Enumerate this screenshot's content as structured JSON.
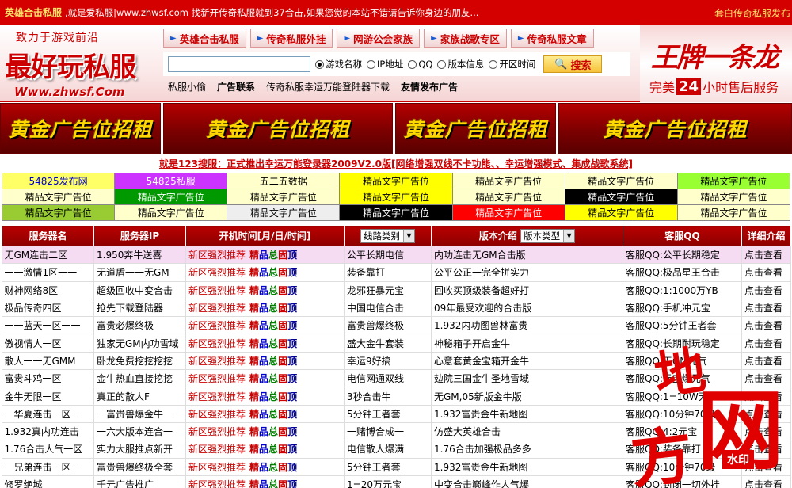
{
  "topbar": {
    "brand": "英雄合击私服",
    "intro": ",就是爱私服|www.zhwsf.com 找新开传奇私服就到37合击,如果您觉的本站不错请告诉你身边的朋友...",
    "right": "套白传奇私服发布"
  },
  "logo": {
    "slogan": "致力于游戏前沿",
    "title": "最好玩私服",
    "url": "Www.zhwsf.Com"
  },
  "nav": {
    "tabs": [
      "英雄合击私服",
      "传奇私服外挂",
      "网游公会家族",
      "家族战歌专区",
      "传奇私服文章"
    ]
  },
  "search": {
    "placeholder": "",
    "options": [
      "游戏名称",
      "IP地址",
      "QQ",
      "版本信息",
      "开区时间"
    ],
    "selected": 0,
    "button": "搜索"
  },
  "sublinks": [
    {
      "label": "私服小偷",
      "bold": false
    },
    {
      "label": "广告联系",
      "bold": true
    },
    {
      "label": "传奇私服幸运万能登陆器下载",
      "bold": false
    },
    {
      "label": "友情发布广告",
      "bold": true
    }
  ],
  "adbrand": {
    "title": "王牌一条龙",
    "sub_prefix": "完美",
    "sub_num": "24",
    "sub_suffix": "小时售后服务"
  },
  "banners": [
    "黄金广告位招租",
    "黄金广告位招租",
    "黄金广告位招租",
    "黄金广告位招租"
  ],
  "notice": "就是123搜服：正式推出幸运万能登录器2009V2.0版[网络增强双线不卡功能、、幸运增强模式、集成战歌系统]",
  "adgrid": [
    [
      {
        "text": "54825发布网",
        "bg": "#ffff66",
        "color": "#0000cc"
      },
      {
        "text": "54825私服",
        "bg": "#cc33ff",
        "color": "#ffffff"
      },
      {
        "text": "五二五数据",
        "bg": "#ffffcc",
        "color": "#000000"
      },
      {
        "text": "精品文字广告位",
        "bg": "#ffff00",
        "color": "#000000"
      },
      {
        "text": "精品文字广告位",
        "bg": "#ffffcc",
        "color": "#000000"
      },
      {
        "text": "精品文字广告位",
        "bg": "#ffffcc",
        "color": "#000000"
      },
      {
        "text": "精品文字广告位",
        "bg": "#99ff33",
        "color": "#000000"
      }
    ],
    [
      {
        "text": "精品文字广告位",
        "bg": "#ffffcc",
        "color": "#000000"
      },
      {
        "text": "精品文字广告位",
        "bg": "#009900",
        "color": "#ffffff"
      },
      {
        "text": "精品文字广告位",
        "bg": "#ffffcc",
        "color": "#000000"
      },
      {
        "text": "精品文字广告位",
        "bg": "#ffff00",
        "color": "#000000"
      },
      {
        "text": "精品文字广告位",
        "bg": "#ffffcc",
        "color": "#000000"
      },
      {
        "text": "精品文字广告位",
        "bg": "#000000",
        "color": "#ffffff"
      },
      {
        "text": "精品文字广告位",
        "bg": "#ffffcc",
        "color": "#000000"
      }
    ],
    [
      {
        "text": "精品文字广告位",
        "bg": "#99cc33",
        "color": "#000000"
      },
      {
        "text": "精品文字广告位",
        "bg": "#ffffcc",
        "color": "#000000"
      },
      {
        "text": "精品文字广告位",
        "bg": "#eeeeee",
        "color": "#000000"
      },
      {
        "text": "精品文字广告位",
        "bg": "#000000",
        "color": "#ffffff"
      },
      {
        "text": "精品文字广告位",
        "bg": "#ff0000",
        "color": "#ffffff"
      },
      {
        "text": "精品文字广告位",
        "bg": "#ffff00",
        "color": "#000000"
      },
      {
        "text": "精品文字广告位",
        "bg": "#ffffcc",
        "color": "#000000"
      }
    ]
  ],
  "table": {
    "headers": {
      "name": "服务器名",
      "ip": "服务器IP",
      "time": "开机时间[月/日/时间]",
      "line_select": "线路类别",
      "version": "版本介绍",
      "version_select": "版本类型",
      "qq": "客服QQ",
      "detail": "详细介绍"
    },
    "tag_labels": [
      "新区强烈推荐",
      "精",
      "品",
      "总",
      "固",
      "顶"
    ],
    "rows": [
      {
        "name": "无GM连击二区",
        "ip": "1.950奔牛送喜",
        "line": "公平长期电信",
        "version": "内功连击无GM合击版",
        "qq": "客服QQ:公平长期稳定",
        "detail": "点击查看"
      },
      {
        "name": "一一激情1区一一",
        "ip": "无道盾一一无GM",
        "line": "装备靠打",
        "version": "公平公正一完全拼实力",
        "qq": "客服QQ:极品星王合击",
        "detail": "点击查看"
      },
      {
        "name": "财神网络8区",
        "ip": "超级回收中变合击",
        "line": "龙邪狂暴元宝",
        "version": "回收买顶级装备超好打",
        "qq": "客服QQ:1:1000万YB",
        "detail": "点击查看"
      },
      {
        "name": "极品传奇四区",
        "ip": "抢先下载登陆器",
        "line": "中国电信合击",
        "version": "09年最受欢迎的合击版",
        "qq": "客服QQ:手机冲元宝",
        "detail": "点击查看"
      },
      {
        "name": "一一蓝天一区一一",
        "ip": "富贵必爆终极",
        "line": "富贵兽爆终极",
        "version": "1.932内功图兽林富贵",
        "qq": "客服QQ:5分钟王者套",
        "detail": "点击查看"
      },
      {
        "name": "傲视情人一区",
        "ip": "独家无GM内功雪域",
        "line": "盛大金牛套装",
        "version": "神秘箱子开启金牛",
        "qq": "客服QQ:长期耐玩稳定",
        "detail": "点击查看"
      },
      {
        "name": "散人一一无GMM",
        "ip": "卧龙免费挖挖挖挖",
        "line": "幸运9好搞",
        "version": "心意套黄金宝箱开金牛",
        "qq": "客服QQ:无GM元气",
        "detail": "点击查看"
      },
      {
        "name": "富贵斗鸡一区",
        "ip": "金牛热血直接挖挖",
        "line": "电信网通双线",
        "version": "攰院三国金牛圣地雪域",
        "qq": "客服QQ:元宝爆元气",
        "detail": "点击查看"
      },
      {
        "name": "金牛无限一区",
        "ip": "真正的散人F",
        "line": "3秒合击牛",
        "version": "无GM,05新版金牛版",
        "qq": "客服QQ:1=10W无GM",
        "detail": "点击查看"
      },
      {
        "name": "一华夏连击一区一",
        "ip": "一富贵兽爆金牛一",
        "line": "5分钟王者套",
        "version": "1.932富贵金牛新地图",
        "qq": "客服QQ:10分钟70级",
        "detail": "点击查看"
      },
      {
        "name": "1.932真内功连击",
        "ip": "一六大版本连合一",
        "line": "一赌博合成一",
        "version": "仿盛大英雄合击",
        "qq": "客服QQ:4:2元宝",
        "detail": "点击查看"
      },
      {
        "name": "1.76合击人气一区",
        "ip": "实力大服推点新开",
        "line": "电信散人爆满",
        "version": "1.76合击加强极品多多",
        "qq": "客服QQ:装备靠打",
        "detail": "点击查看"
      },
      {
        "name": "一兄弟连击一区一",
        "ip": "富贵兽爆终极全套",
        "line": "5分钟王者套",
        "version": "1.932富贵金牛新地图",
        "qq": "客服QQ:10分钟70级",
        "detail": "点击查看"
      },
      {
        "name": "修罗绝城",
        "ip": "千元广告推广",
        "line": "1=20万元宝",
        "version": "中变合击巅峰作人气爆",
        "qq": "客服QQ:封闭一切外挂",
        "detail": "点击查看"
      }
    ]
  },
  "watermark": {
    "chars": [
      "地",
      "网",
      "方"
    ],
    "label": "水印"
  },
  "colors": {
    "primary_red": "#d40000",
    "header_red": "#b90000",
    "gold": "#ffd800",
    "link_blue": "#0000cc"
  }
}
